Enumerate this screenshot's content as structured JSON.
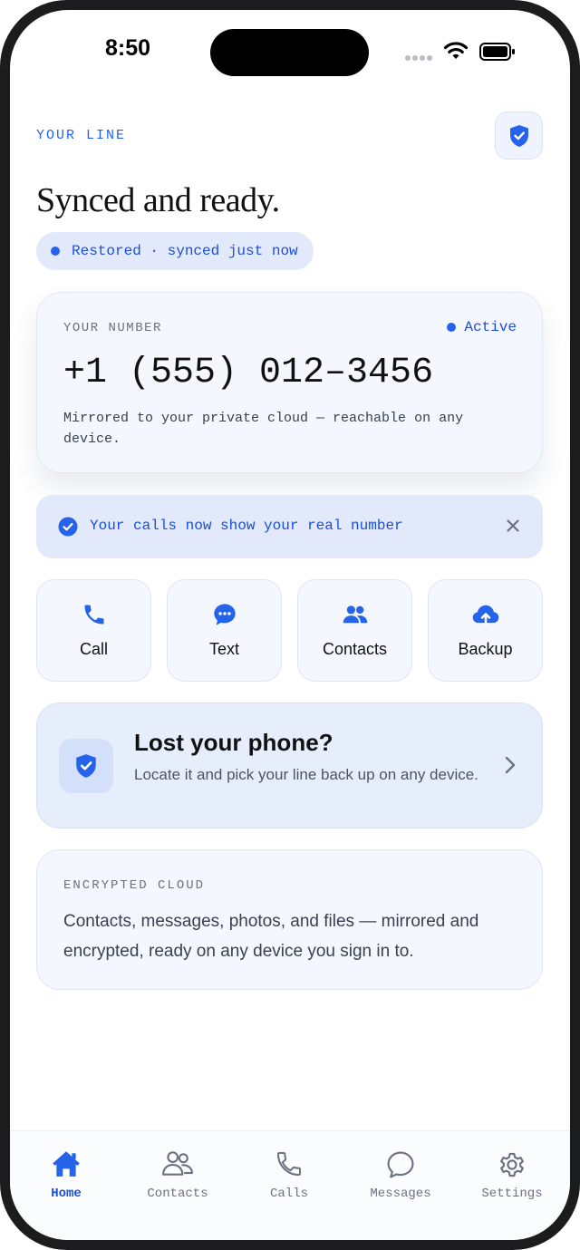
{
  "status_bar": {
    "time": "8:50"
  },
  "header": {
    "eyebrow": "YOUR LINE",
    "title": "Synced and ready.",
    "status_pill": "Restored · synced just now"
  },
  "number_card": {
    "label": "YOUR NUMBER",
    "status": "Active",
    "number": "+1 (555) 012–3456",
    "description": "Mirrored to your private cloud — reachable on any device."
  },
  "banner": {
    "text": "Your calls now show your real number"
  },
  "actions": [
    {
      "label": "Call",
      "icon": "phone-icon"
    },
    {
      "label": "Text",
      "icon": "chat-bubble-icon"
    },
    {
      "label": "Contacts",
      "icon": "people-icon"
    },
    {
      "label": "Backup",
      "icon": "cloud-upload-icon"
    }
  ],
  "lost_card": {
    "title": "Lost your phone?",
    "description": "Locate it and pick your line back up on any device."
  },
  "cloud_card": {
    "label": "ENCRYPTED CLOUD",
    "description": "Contacts, messages, photos, and files — mirrored and encrypted, ready on any device you sign in to."
  },
  "tabs": [
    {
      "label": "Home",
      "icon": "home-icon",
      "active": true
    },
    {
      "label": "Contacts",
      "icon": "people-outline-icon",
      "active": false
    },
    {
      "label": "Calls",
      "icon": "phone-outline-icon",
      "active": false
    },
    {
      "label": "Messages",
      "icon": "chat-outline-icon",
      "active": false
    },
    {
      "label": "Settings",
      "icon": "gear-icon",
      "active": false
    }
  ],
  "colors": {
    "accent": "#2563eb",
    "accent_text": "#1d4ed8",
    "card_bg": "#f4f7fd",
    "tint_bg": "#e1e9fb",
    "inactive_tab": "#6b7280"
  }
}
